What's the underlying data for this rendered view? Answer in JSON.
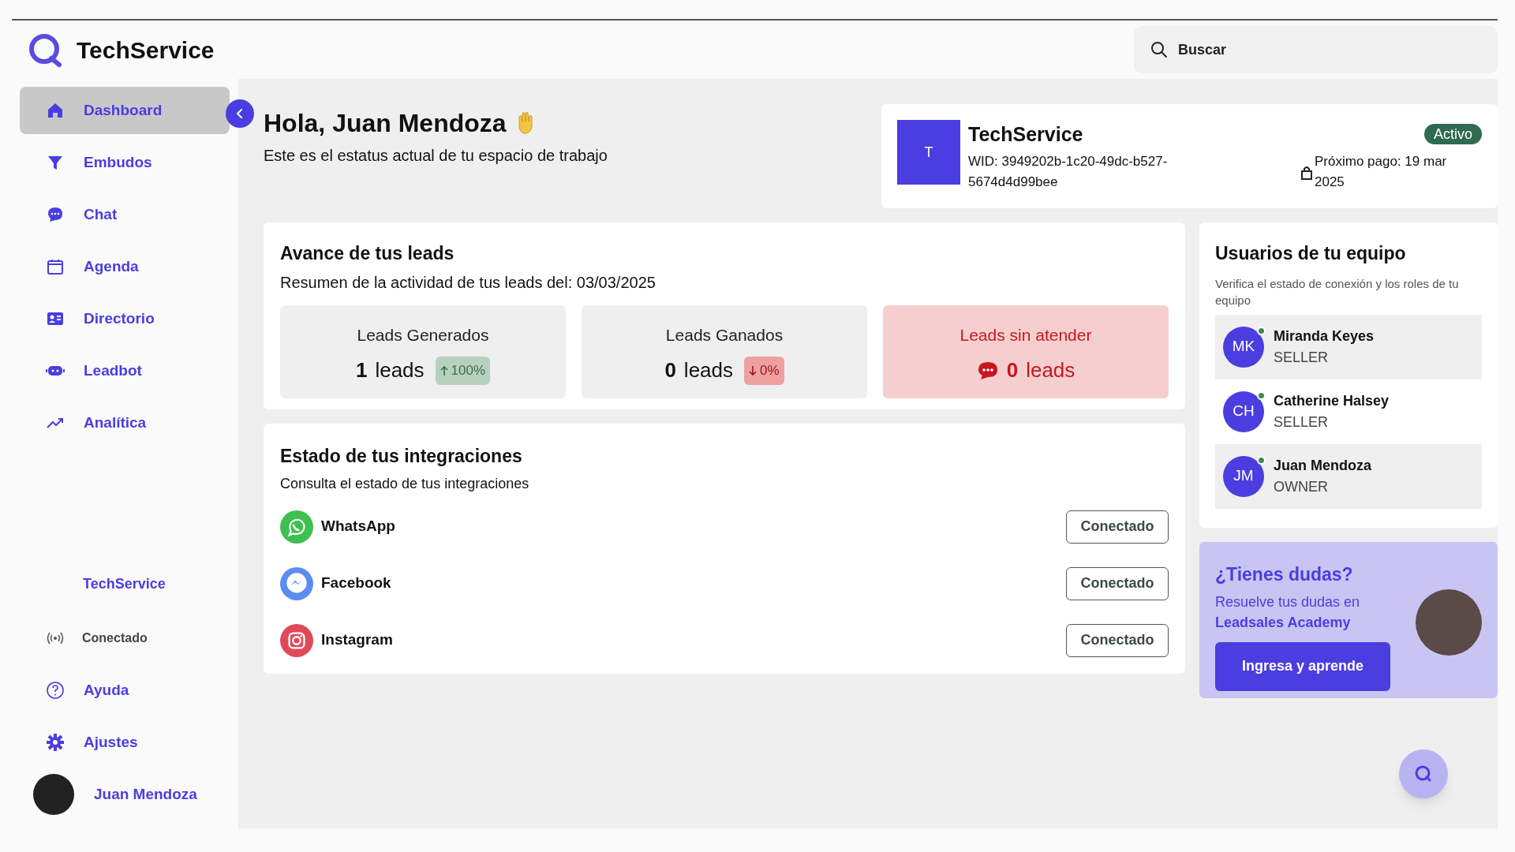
{
  "brand": {
    "name": "TechService"
  },
  "search": {
    "placeholder": "Buscar"
  },
  "sidebar": {
    "items": [
      {
        "label": "Dashboard",
        "selected": true
      },
      {
        "label": "Embudos",
        "selected": false
      },
      {
        "label": "Chat",
        "selected": false
      },
      {
        "label": "Agenda",
        "selected": false
      },
      {
        "label": "Directorio",
        "selected": false
      },
      {
        "label": "Leadbot",
        "selected": false
      },
      {
        "label": "Analítica",
        "selected": false
      }
    ],
    "workspace": "TechService",
    "connection": "Conectado",
    "bottom_items": [
      {
        "label": "Ayuda"
      },
      {
        "label": "Ajustes"
      }
    ],
    "user": "Juan Mendoza"
  },
  "greeting": {
    "title": "Hola, Juan Mendoza",
    "subtitle": "Este es el estatus actual de tu espacio de trabajo"
  },
  "workspace_card": {
    "initial": "T",
    "name": "TechService",
    "wid": "WID: 3949202b-1c20-49dc-b527-5674d4d99bee",
    "status": "Activo",
    "next_payment": "Próximo pago: 19 mar 2025"
  },
  "leads": {
    "title": "Avance de tus leads",
    "subtitle": "Resumen de la actividad de tus leads del: 03/03/2025",
    "stats": [
      {
        "kind": "generated",
        "label": "Leads Generados",
        "count": "1",
        "unit": "leads",
        "change": {
          "text": "100%",
          "kind": "up"
        }
      },
      {
        "kind": "won",
        "label": "Leads Ganados",
        "count": "0",
        "unit": "leads",
        "change": {
          "text": "0%",
          "kind": "down"
        }
      },
      {
        "kind": "unattended",
        "label": "Leads sin atender",
        "count": "0",
        "unit": "leads"
      }
    ]
  },
  "integrations": {
    "title": "Estado de tus integraciones",
    "subtitle": "Consulta el estado de tus integraciones",
    "items": [
      {
        "name": "WhatsApp",
        "kind": "whatsapp",
        "status": "Conectado"
      },
      {
        "name": "Facebook",
        "kind": "messenger",
        "status": "Conectado"
      },
      {
        "name": "Instagram",
        "kind": "instagram",
        "status": "Conectado"
      }
    ]
  },
  "team": {
    "title": "Usuarios de tu equipo",
    "subtitle": "Verifica el estado de conexión y los roles de tu equipo",
    "members": [
      {
        "initials": "MK",
        "name": "Miranda Keyes",
        "role": "SELLER",
        "online": true,
        "selected": true
      },
      {
        "initials": "CH",
        "name": "Catherine Halsey",
        "role": "SELLER",
        "online": true,
        "selected": false
      },
      {
        "initials": "JM",
        "name": "Juan Mendoza",
        "role": "OWNER",
        "online": true,
        "selected": true
      }
    ]
  },
  "academy": {
    "title": "¿Tienes dudas?",
    "text": "Resuelve tus dudas en",
    "link": "Leadsales Academy",
    "button": "Ingresa y aprende"
  }
}
